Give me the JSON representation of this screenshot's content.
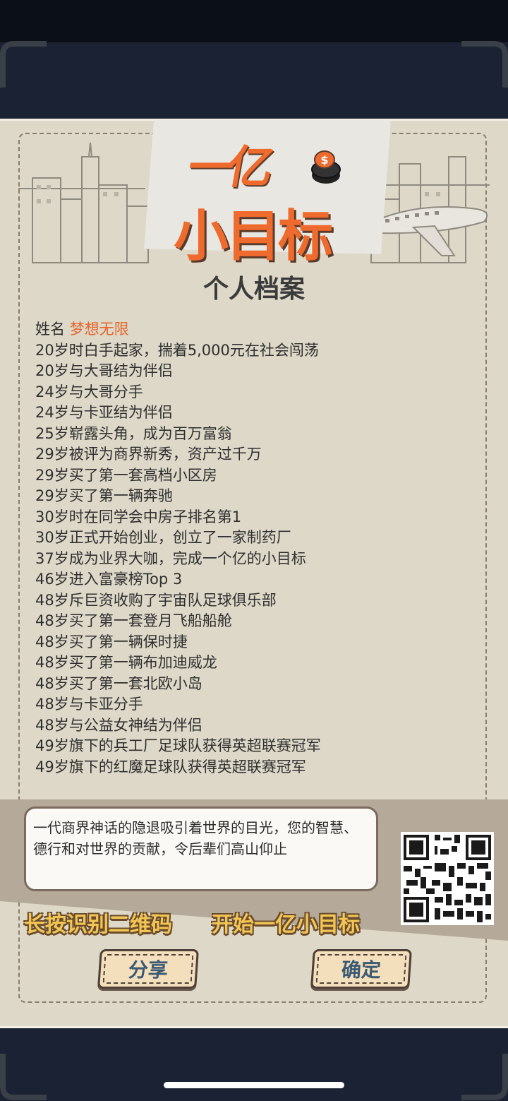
{
  "logo": {
    "line1": "一亿",
    "line2": "小目标"
  },
  "title": "个人档案",
  "profile": {
    "name_label": "姓名",
    "name_value": "梦想无限",
    "events": [
      "20岁时白手起家，揣着5,000元在社会闯荡",
      "20岁与大哥结为伴侣",
      "24岁与大哥分手",
      "24岁与卡亚结为伴侣",
      "25岁崭露头角，成为百万富翁",
      "29岁被评为商界新秀，资产过千万",
      "29岁买了第一套高档小区房",
      "29岁买了第一辆奔驰",
      "30岁时在同学会中房子排名第1",
      "30岁正式开始创业，创立了一家制药厂",
      "37岁成为业界大咖，完成一个亿的小目标",
      "46岁进入富豪榜Top 3",
      "48岁斥巨资收购了宇宙队足球俱乐部",
      "48岁买了第一套登月飞船船舱",
      "48岁买了第一辆保时捷",
      "48岁买了第一辆布加迪威龙",
      "48岁买了第一套北欧小岛",
      "48岁与卡亚分手",
      "48岁与公益女神结为伴侣",
      "49岁旗下的兵工厂足球队获得英超联赛冠军",
      "49岁旗下的红魔足球队获得英超联赛冠军"
    ]
  },
  "summary": "一代商界神话的隐退吸引着世界的目光，您的智慧、德行和对世界的贡献，令后辈们高山仰止",
  "slogans": {
    "left": "长按识别二维码",
    "right": "开始一亿小目标"
  },
  "buttons": {
    "share": "分享",
    "confirm": "确定"
  },
  "colors": {
    "accent": "#e6652b",
    "background": "#1b2233",
    "panel": "#ddd8c8",
    "button": "#f4dfbd"
  }
}
